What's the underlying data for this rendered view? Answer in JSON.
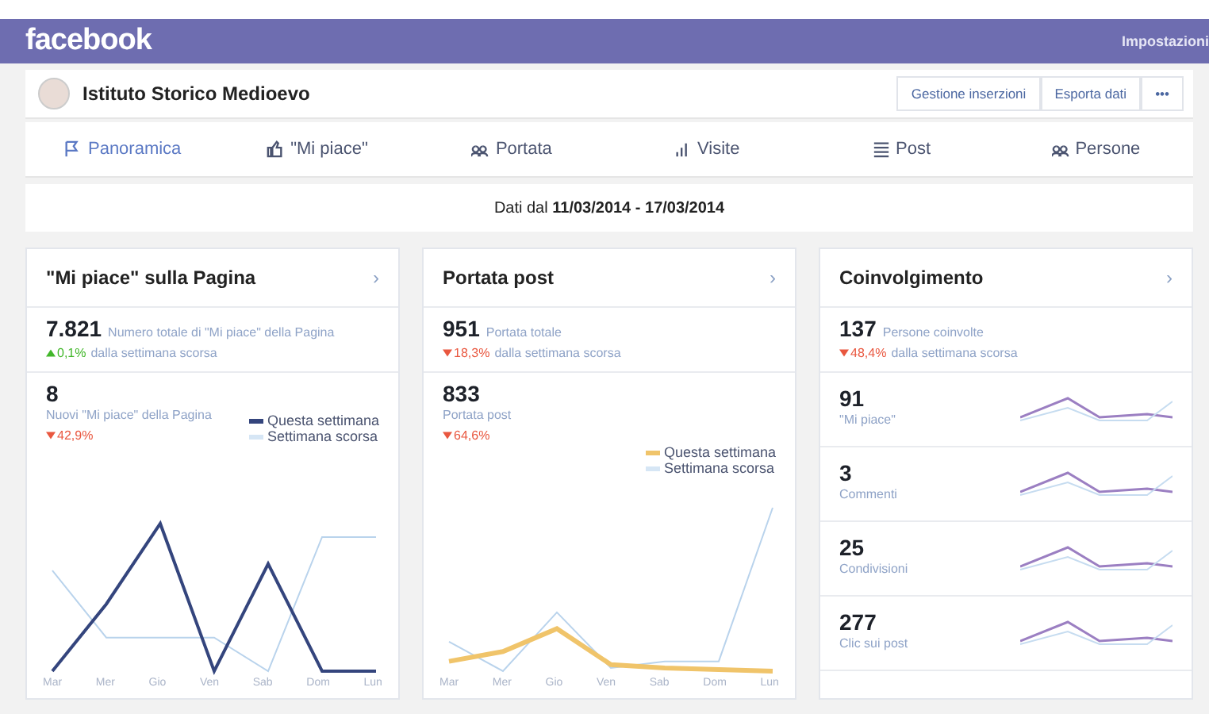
{
  "topbar": {
    "logo": "facebook",
    "settings": "Impostazioni"
  },
  "page": {
    "name": "Istituto Storico Medioevo",
    "actions": [
      "Gestione inserzioni",
      "Esporta dati"
    ],
    "more": "•••"
  },
  "tabs": [
    {
      "label": "Panoramica",
      "selected": true
    },
    {
      "label": "\"Mi piace\"",
      "selected": false
    },
    {
      "label": "Portata",
      "selected": false
    },
    {
      "label": "Visite",
      "selected": false
    },
    {
      "label": "Post",
      "selected": false
    },
    {
      "label": "Persone",
      "selected": false
    }
  ],
  "date_range": "Dati dal **11/03/2014 - 17/03/2014**",
  "cards": [
    {
      "title": "\"Mi piace\" sulla Pagina",
      "chevron": "›",
      "kind": "likes",
      "stat": {
        "value": "7.821",
        "label": "Numero totale di \"Mi piace\" della Pagina",
        "change": "0,1%",
        "rising": true,
        "change_note": "dalla settimana scorsa"
      },
      "sub": {
        "value": "8",
        "label": "Nuovi \"Mi piace\" della Pagina",
        "change": "42,9%",
        "rising": false
      },
      "legend": [
        "Questa settimana",
        "Settimana scorsa"
      ],
      "days": [
        "Mar",
        "Mer",
        "Gio",
        "Ven",
        "Sab",
        "Dom",
        "Lun"
      ]
    },
    {
      "title": "Portata post",
      "chevron": "›",
      "kind": "reach",
      "stat": {
        "value": "951",
        "label": "Portata totale",
        "change": "18,3%",
        "rising": false,
        "change_note": "dalla settimana scorsa"
      },
      "sub": {
        "value": "833",
        "label": "Portata post",
        "change": "64,6%",
        "rising": false
      },
      "legend": [
        "Questa settimana",
        "Settimana scorsa"
      ],
      "days": [
        "Mar",
        "Mer",
        "Gio",
        "Ven",
        "Sab",
        "Dom",
        "Lun"
      ]
    },
    {
      "title": "Coinvolgimento",
      "chevron": "›",
      "kind": "engagement",
      "stat": {
        "value": "137",
        "label": "Persone coinvolte",
        "change": "48,4%",
        "rising": false,
        "change_note": "dalla settimana scorsa"
      },
      "rows": [
        {
          "value": "91",
          "label": "\"Mi piace\""
        },
        {
          "value": "3",
          "label": "Commenti"
        },
        {
          "value": "25",
          "label": "Condivisioni"
        },
        {
          "value": "277",
          "label": "Clic sui post"
        }
      ]
    }
  ]
}
